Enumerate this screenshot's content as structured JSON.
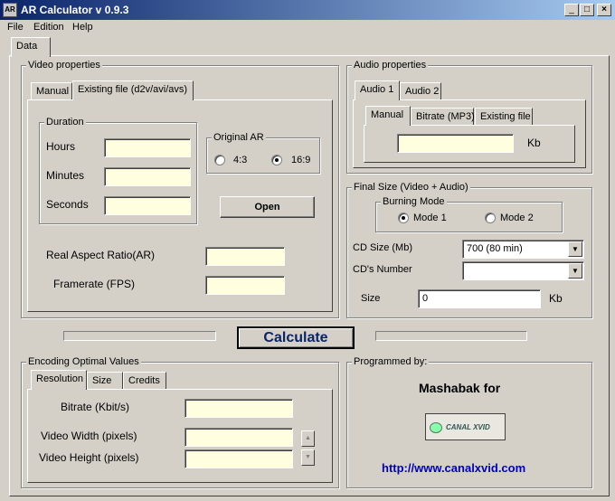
{
  "window": {
    "title": "AR Calculator v 0.9.3",
    "icon_text": "AR",
    "minimize": "_",
    "maximize": "□",
    "close": "×"
  },
  "menu": [
    "File",
    "Edition",
    "Help"
  ],
  "main_tab": "Data",
  "video": {
    "legend": "Video properties",
    "tabs": [
      "Manual",
      "Existing file (d2v/avi/avs)"
    ],
    "duration": {
      "legend": "Duration",
      "hours_label": "Hours",
      "minutes_label": "Minutes",
      "seconds_label": "Seconds"
    },
    "original_ar": {
      "legend": "Original AR",
      "options": [
        "4:3",
        "16:9"
      ],
      "selected": "16:9"
    },
    "open_label": "Open",
    "real_ar_label": "Real Aspect Ratio(AR)",
    "framerate_label": "Framerate (FPS)"
  },
  "audio": {
    "legend": "Audio properties",
    "tabs": [
      "Audio 1",
      "Audio 2"
    ],
    "subtabs": [
      "Manual",
      "Bitrate (MP3)",
      "Existing file"
    ],
    "unit": "Kb"
  },
  "final_size": {
    "legend": "Final Size (Video + Audio)",
    "burning_mode": {
      "legend": "Burning Mode",
      "options": [
        "Mode 1",
        "Mode 2"
      ],
      "selected": "Mode 1"
    },
    "cd_size_label": "CD Size (Mb)",
    "cd_size_value": "700 (80 min)",
    "cd_number_label": "CD's Number",
    "cd_number_value": "",
    "size_label": "Size",
    "size_value": "0",
    "size_unit": "Kb",
    "combo_arrow": "▼"
  },
  "calculate_label": "Calculate",
  "encoding": {
    "legend": "Encoding Optimal Values",
    "tabs": [
      "Resolution",
      "Size",
      "Credits"
    ],
    "bitrate_label": "Bitrate (Kbit/s)",
    "width_label": "Video Width (pixels)",
    "height_label": "Video Height (pixels)",
    "spin_up": "▲",
    "spin_down": "▼"
  },
  "credits": {
    "legend": "Programmed by:",
    "author": "Mashabak for",
    "logo_text": "CANAL XVID",
    "url": "http://www.canalxvid.com"
  }
}
